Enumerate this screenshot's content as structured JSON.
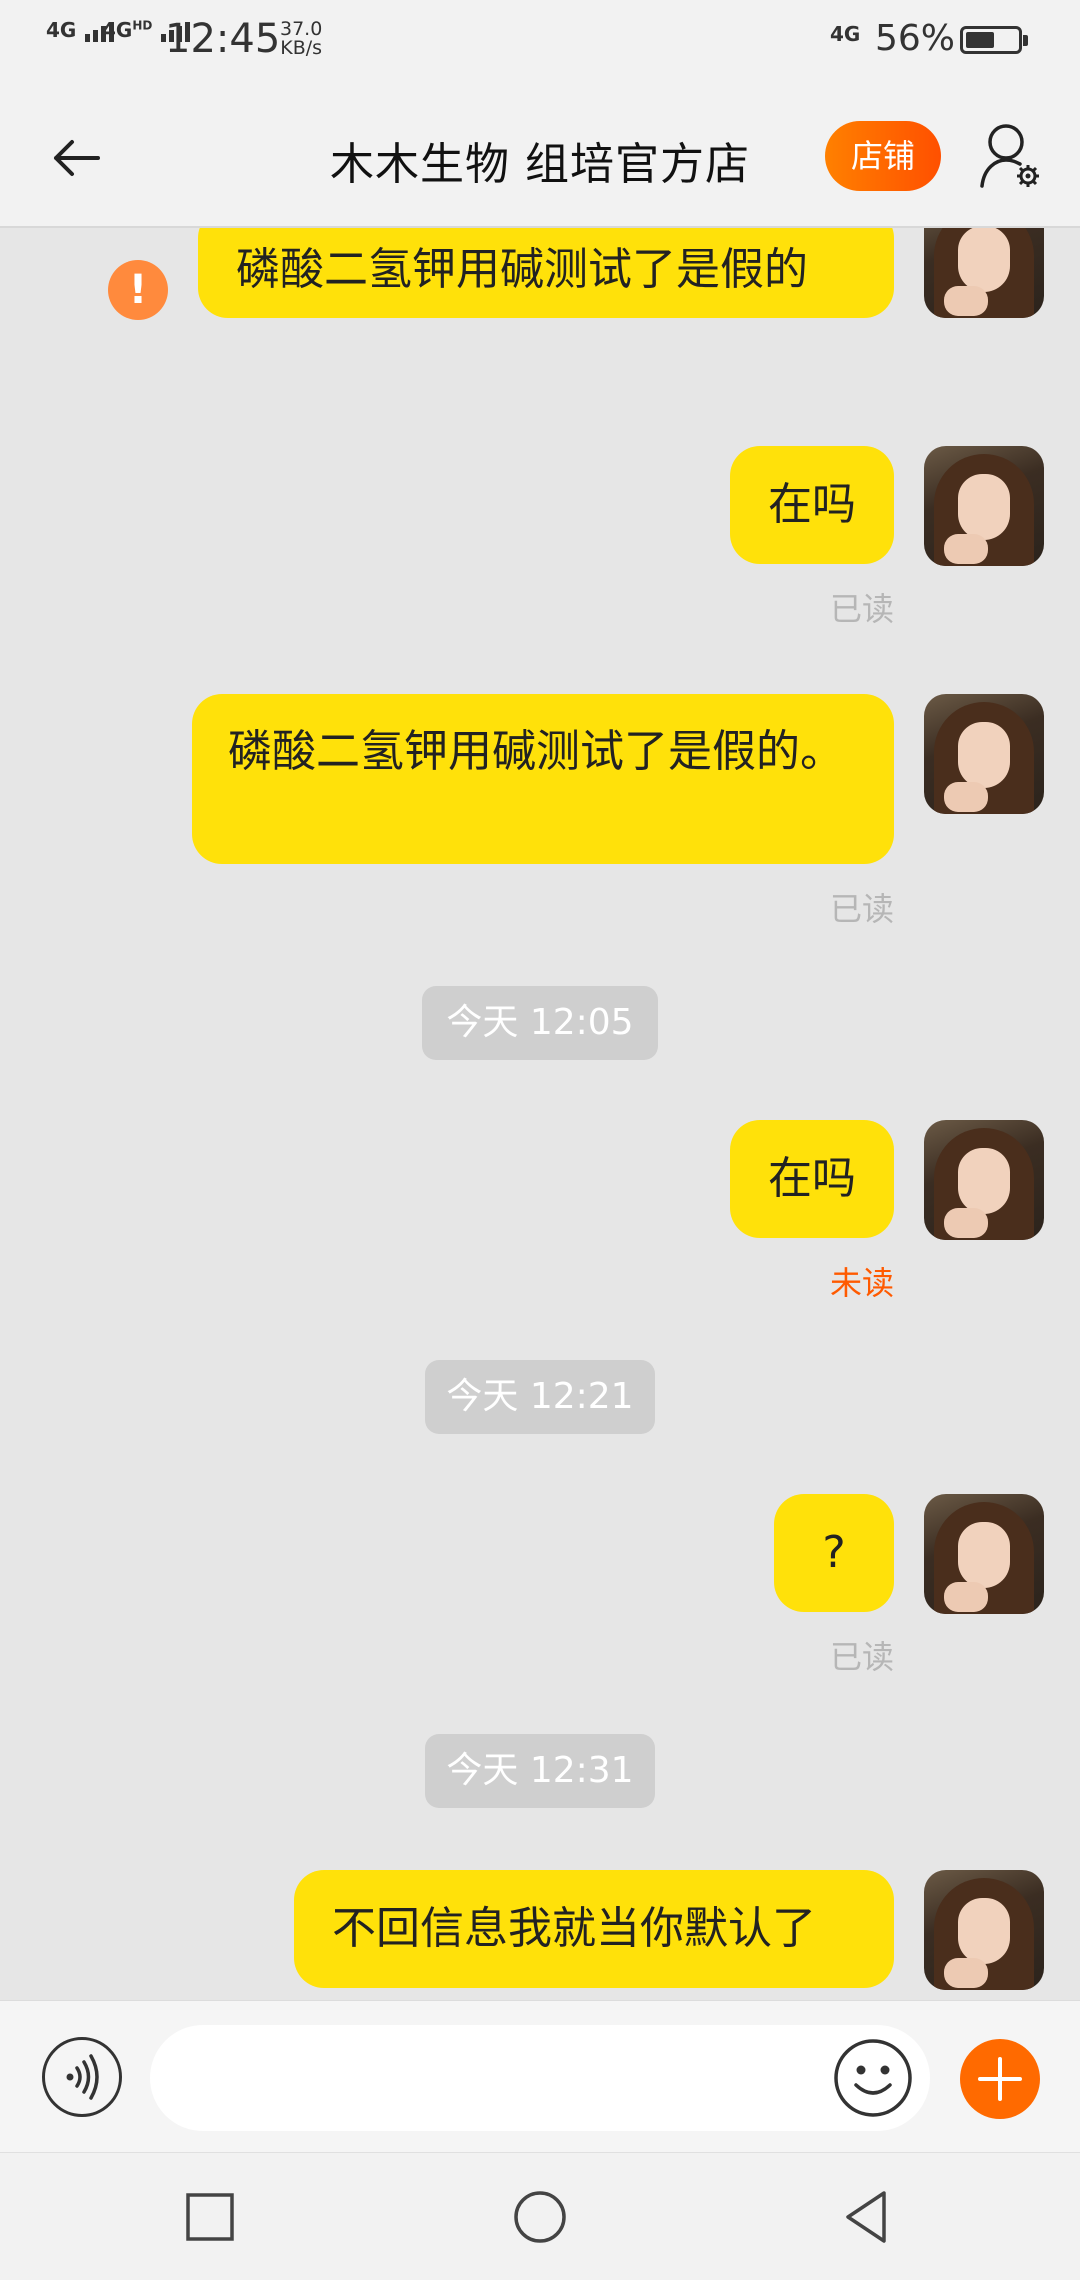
{
  "status_bar": {
    "net1": "4G",
    "net2": "4G",
    "net2_sup": "HD",
    "time": "12:45",
    "speed_value": "37.0",
    "speed_unit": "KB/s",
    "right_net": "4G",
    "battery_percent": "56%",
    "battery_level": 0.56
  },
  "header": {
    "back_icon": "arrow-left-icon",
    "title": "木木生物 组培官方店",
    "shop_label": "店铺",
    "shop_color": "#ff6a00",
    "profile_icon": "user-settings-icon"
  },
  "messages": [
    {
      "text": "磷酸二氢钾用碱测试了是假的",
      "status": "failed"
    },
    {
      "text": "在吗",
      "status": "已读"
    },
    {
      "text": "磷酸二氢钾用碱测试了是假的。",
      "status": "已读"
    },
    {
      "time": "今天  12:05"
    },
    {
      "text": "在吗",
      "status": "未读"
    },
    {
      "time": "今天  12:21"
    },
    {
      "text": "?",
      "status": "已读"
    },
    {
      "time": "今天  12:31"
    },
    {
      "text": "不回信息我就当你默认了"
    }
  ],
  "colors": {
    "bubble": "#ffe10a",
    "unread": "#ff5a00",
    "read": "#b6b6b6",
    "background": "#e6e6e6"
  },
  "input_bar": {
    "voice_icon": "voice-icon",
    "input_value": "",
    "emoji_icon": "emoji-icon",
    "plus_icon": "plus-icon"
  },
  "nav_bar": {
    "recents_icon": "square-icon",
    "home_icon": "circle-icon",
    "back_icon": "triangle-back-icon"
  }
}
